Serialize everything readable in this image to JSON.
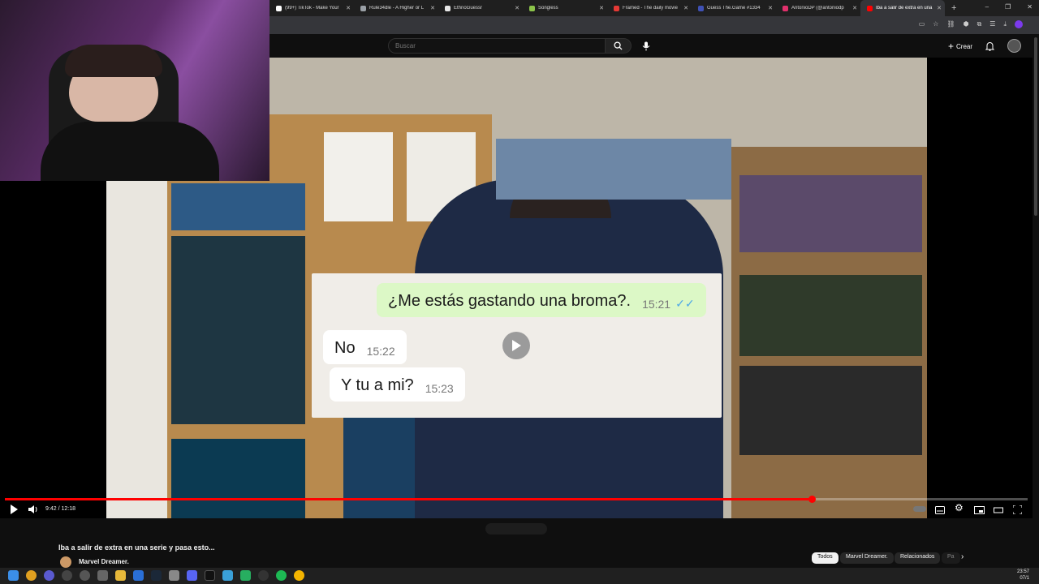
{
  "browser": {
    "tabs": [
      {
        "title": "(99+) TikTok - Make Your",
        "favicon_color": "#ffffff",
        "active": false
      },
      {
        "title": "Rule34dle - A Higher or L",
        "favicon_color": "#9aa0a6",
        "active": false
      },
      {
        "title": "EthnoGuessr",
        "favicon_color": "#e8e8e8",
        "active": false
      },
      {
        "title": "Songless",
        "favicon_color": "#8bc34a",
        "active": false
      },
      {
        "title": "Framed - The daily movie",
        "favicon_color": "#e53935",
        "active": false
      },
      {
        "title": "Guess The.Game #1334",
        "favicon_color": "#3f51b5",
        "active": false
      },
      {
        "title": "AntonioDP (@antoniodp",
        "favicon_color": "#e1306c",
        "active": false
      },
      {
        "title": "Iba a salir de extra en una",
        "favicon_color": "#ff0000",
        "active": true
      }
    ],
    "new_tab": "+",
    "window_controls": [
      "–",
      "❐",
      "✕"
    ]
  },
  "masthead": {
    "search_placeholder": "Buscar",
    "create_label": "Crear"
  },
  "chat_overlay": {
    "messages": [
      {
        "text": "¿Me estás gastando una broma?.",
        "time": "15:21",
        "sent": true,
        "read_ticks": "✓✓"
      },
      {
        "text": "No",
        "time": "15:22",
        "sent": false
      },
      {
        "text": "Y tu a mi?",
        "time": "15:23",
        "sent": false
      }
    ]
  },
  "player": {
    "current_time": "9:42",
    "duration": "12:18",
    "time_display": "9:42 / 12:18",
    "progress_fraction": 0.789,
    "accent_color": "#ff0000"
  },
  "video": {
    "title": "Iba a salir de extra en una serie y pasa esto...",
    "channel": "Marvel Dreamer."
  },
  "chips": [
    {
      "label": "Todos",
      "selected": true
    },
    {
      "label": "Marvel Dreamer.",
      "selected": false
    },
    {
      "label": "Relacionados",
      "selected": false
    },
    {
      "label": "Pa",
      "selected": false
    }
  ],
  "taskbar": {
    "time": "23:57",
    "date": "07/1"
  }
}
